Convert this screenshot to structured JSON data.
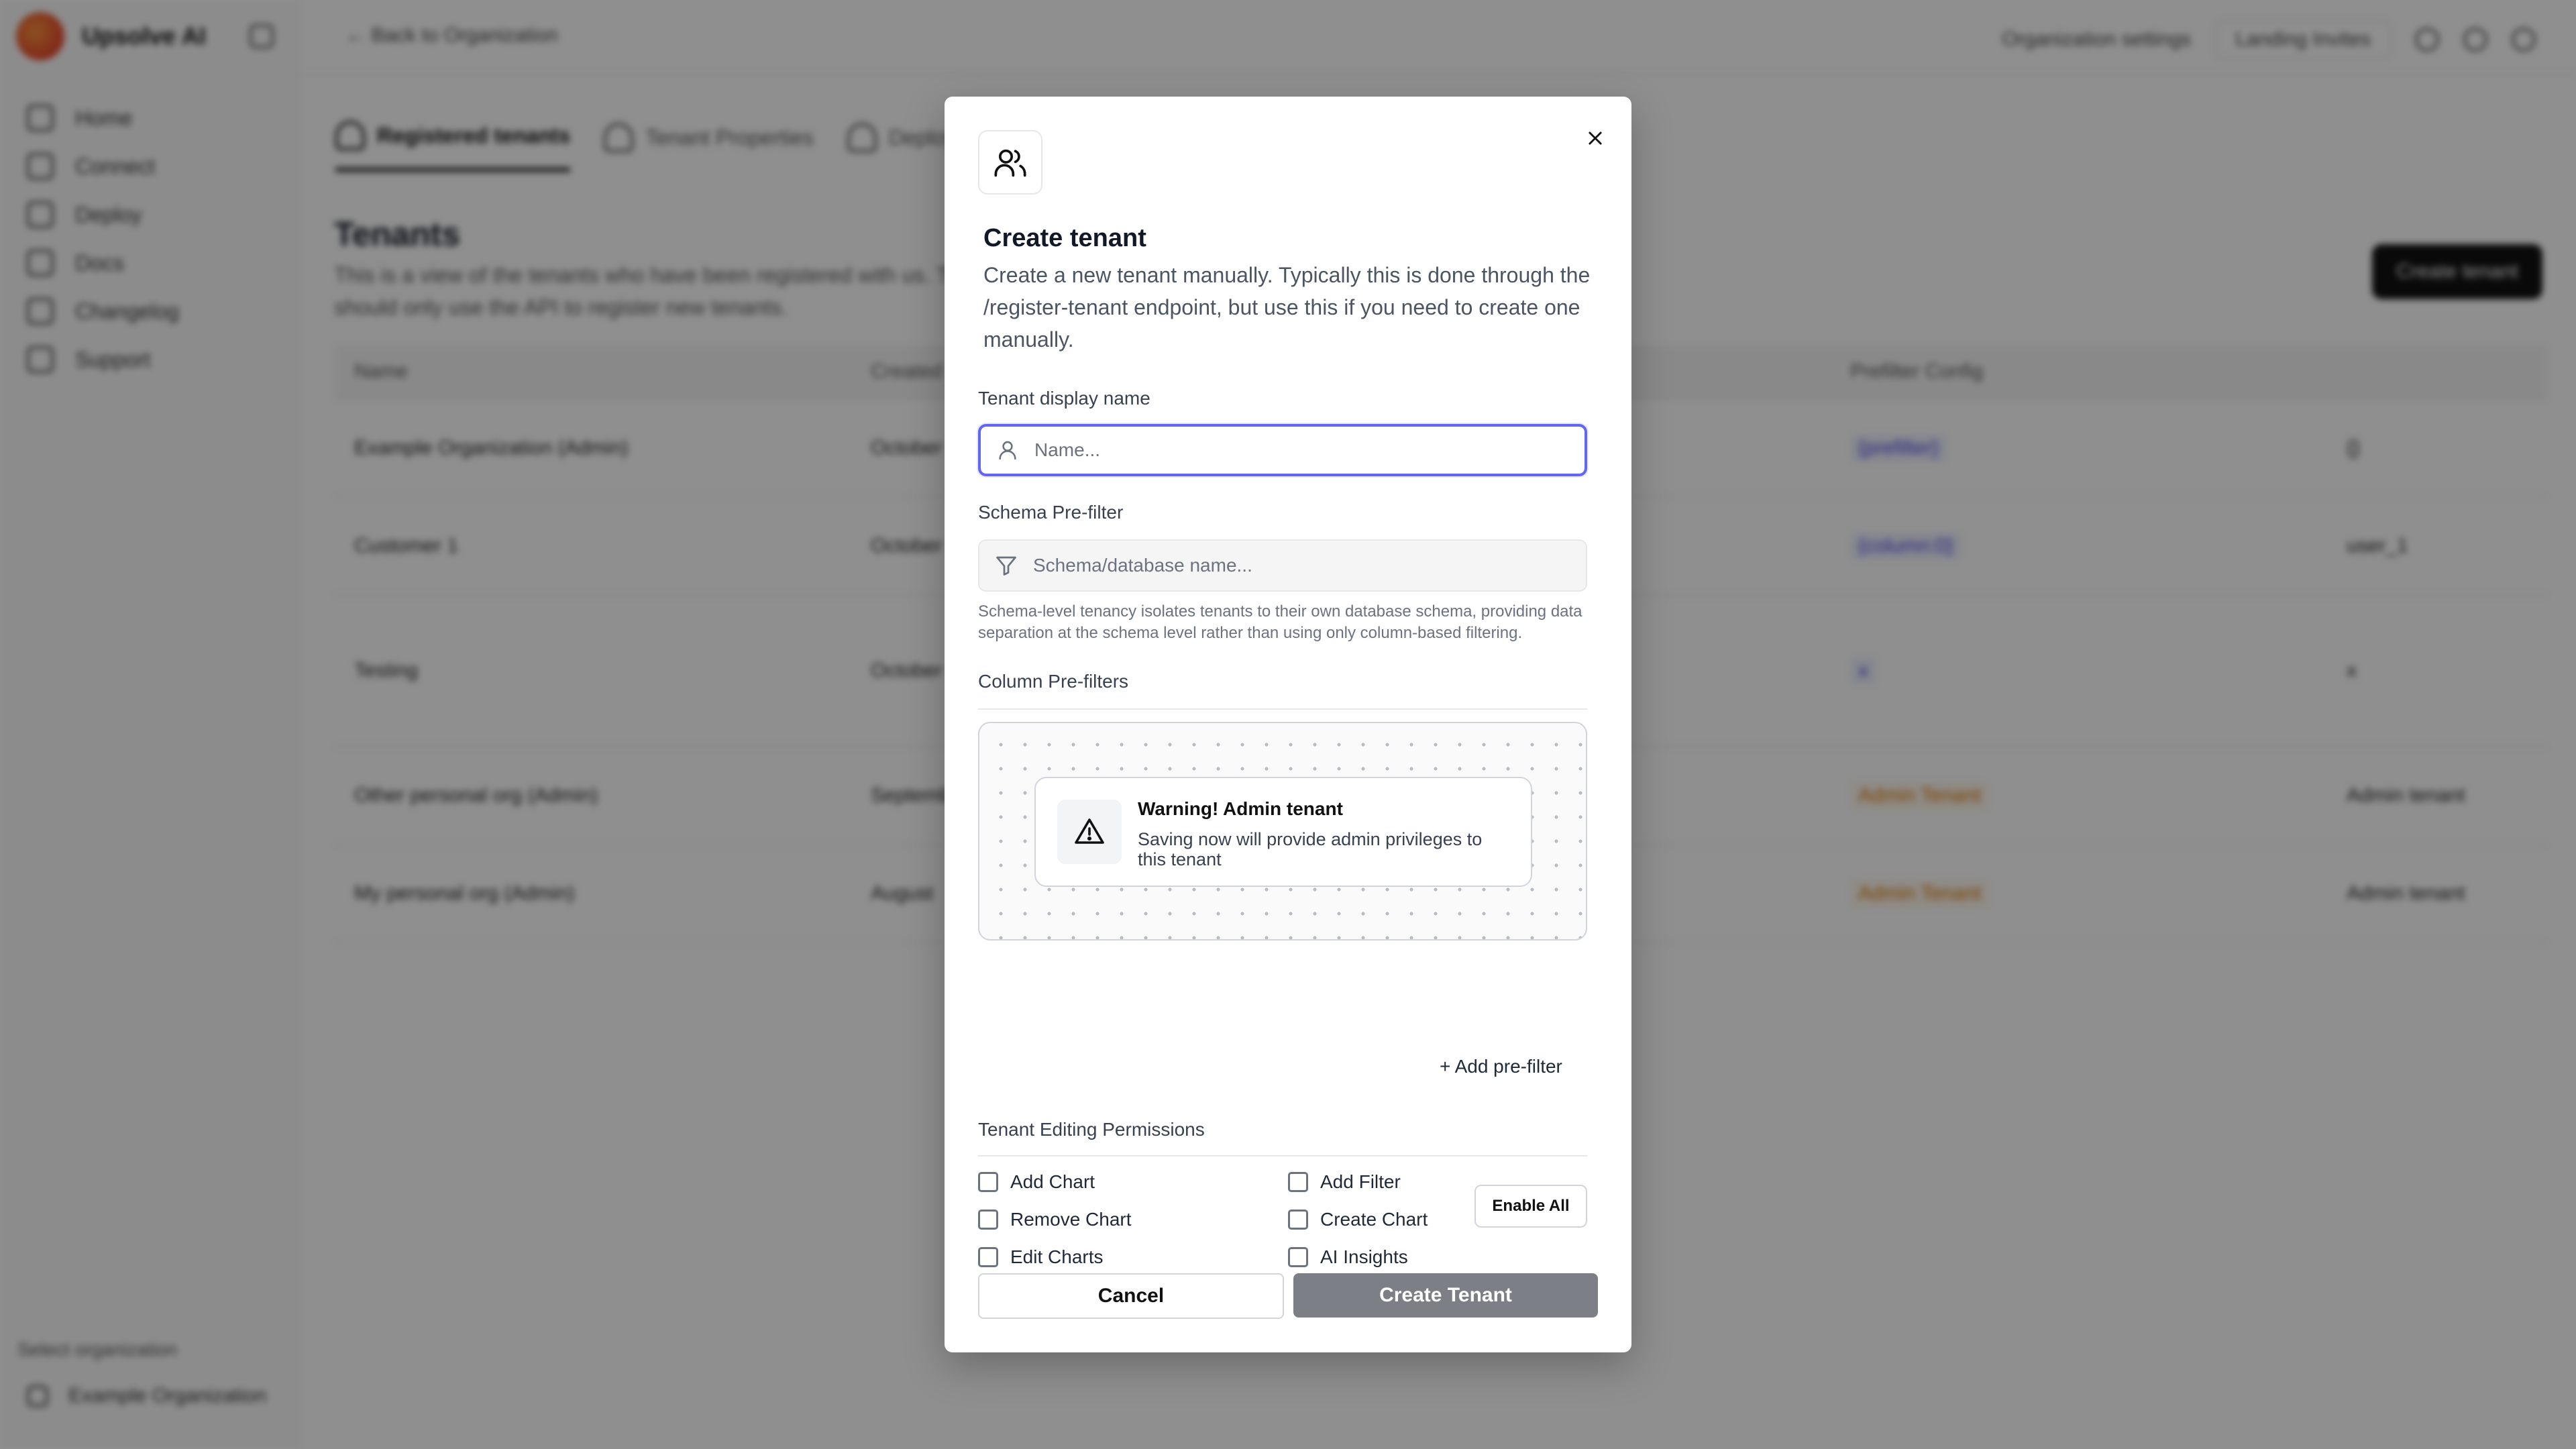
{
  "app": {
    "brand_name": "Upsolve AI",
    "back_link": "← Back to Organization",
    "org_settings": "Organization settings",
    "user_pill": "Landing Invites",
    "nav": [
      "Home",
      "Connect",
      "Deploy",
      "Docs",
      "Changelog",
      "Support"
    ],
    "select_org_label": "Select organization",
    "org_name": "Example Organization",
    "tabs": [
      "Registered tenants",
      "Tenant Properties",
      "Deploy"
    ],
    "page_title": "Tenants",
    "page_desc": "This is a view of the tenants who have been registered with us. Typically, you should only use the API to register new tenants.",
    "create_button": "Create tenant",
    "table": {
      "headers": [
        "Name",
        "Created",
        "Prefilter Config"
      ],
      "rows": [
        {
          "name": "Example Organization (Admin)",
          "created": "October",
          "config": "{prefilter}",
          "extra": "{}",
          "tone": "indigo"
        },
        {
          "name": "Customer 1",
          "created": "October",
          "config": "{column:0}",
          "extra": "user_1",
          "tone": "indigo"
        },
        {
          "name": "Testing",
          "created": "October",
          "config": "x",
          "extra": "x",
          "tone": "indigo"
        },
        {
          "name": "Other personal org (Admin)",
          "created": "September",
          "config": "Admin Tenant",
          "extra": "Admin tenant",
          "tone": "amber"
        },
        {
          "name": "My personal org (Admin)",
          "created": "August",
          "config": "Admin Tenant",
          "extra": "Admin tenant",
          "tone": "amber"
        }
      ]
    }
  },
  "modal": {
    "title": "Create tenant",
    "description": "Create a new tenant manually. Typically this is done through the /register-tenant endpoint, but use this if you need to create one manually.",
    "display_name": {
      "label": "Tenant display name",
      "placeholder": "Name...",
      "value": ""
    },
    "schema": {
      "label": "Schema Pre-filter",
      "placeholder": "Schema/database name...",
      "value": "",
      "helper": "Schema-level tenancy isolates tenants to their own database schema, providing data separation at the schema level rather than using only column-based filtering."
    },
    "column_prefilters": {
      "label": "Column Pre-filters",
      "warning_title": "Warning! Admin tenant",
      "warning_text": "Saving now will provide admin privileges to this tenant",
      "add_label": "+ Add pre-filter"
    },
    "permissions": {
      "label": "Tenant Editing Permissions",
      "items": [
        {
          "label": "Add Chart",
          "checked": false
        },
        {
          "label": "Add Filter",
          "checked": false
        },
        {
          "label": "Remove Chart",
          "checked": false
        },
        {
          "label": "Create Chart",
          "checked": false
        },
        {
          "label": "Edit Charts",
          "checked": false
        },
        {
          "label": "AI Insights",
          "checked": false
        }
      ],
      "enable_all": "Enable All"
    },
    "cancel_label": "Cancel",
    "submit_label": "Create Tenant",
    "colors": {
      "focus_ring": "#6366f1",
      "submit_bg": "#7c7f86"
    }
  }
}
